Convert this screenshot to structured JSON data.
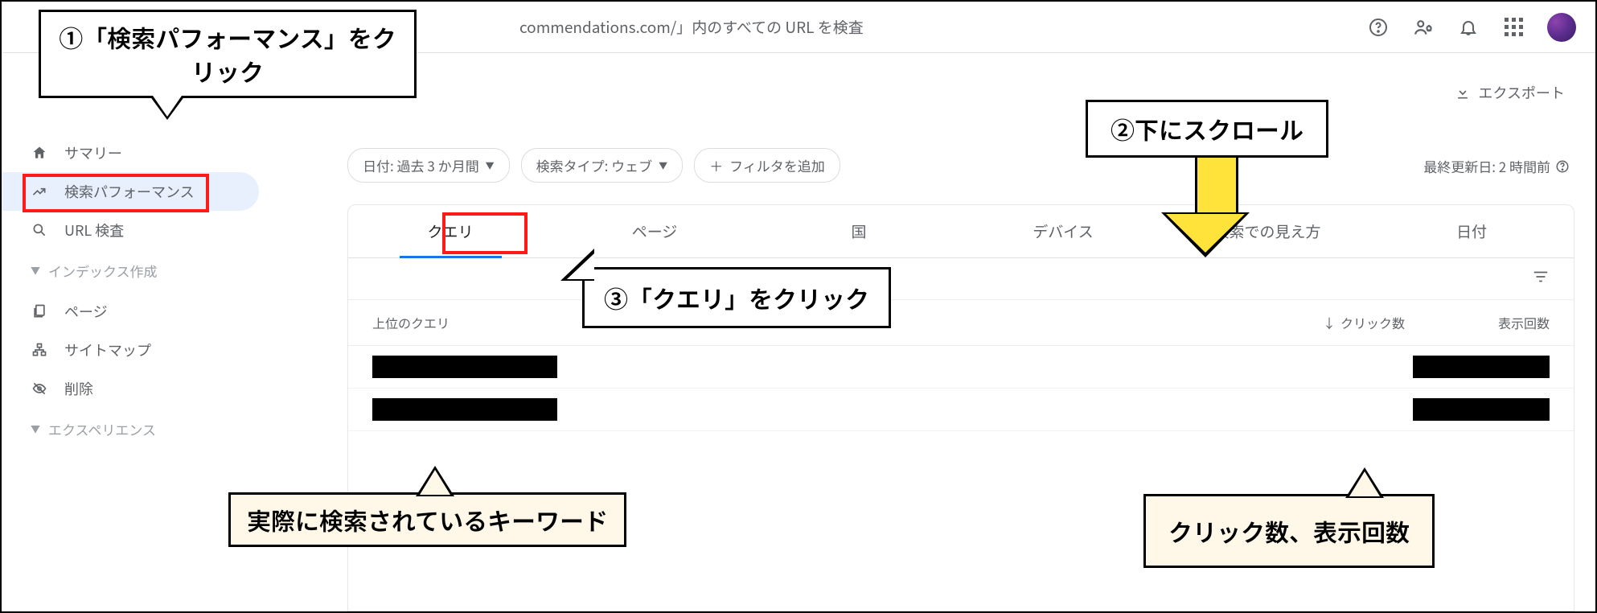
{
  "topbar": {
    "search_hint": "commendations.com/」内のすべての URL を検査"
  },
  "export_label": "エクスポート",
  "sidebar": {
    "summary": "サマリー",
    "performance": "検索パフォーマンス",
    "url_inspect": "URL 検査",
    "section_indexing": "インデックス作成",
    "pages": "ページ",
    "sitemap": "サイトマップ",
    "removals": "削除",
    "section_experience": "エクスペリエンス"
  },
  "chips": {
    "date": "日付: 過去 3 か月間",
    "type": "検索タイプ: ウェブ",
    "add_filter": "フィルタを追加"
  },
  "last_update": "最終更新日: 2 時間前",
  "tabs": {
    "query": "クエリ",
    "page": "ページ",
    "country": "国",
    "device": "デバイス",
    "appearance": "検索での見え方",
    "date": "日付"
  },
  "table": {
    "top_queries": "上位のクエリ",
    "clicks": "クリック数",
    "impressions": "表示回数"
  },
  "callouts": {
    "c1": "①「検索パフォーマンス」をクリック",
    "c2": "②下にスクロール",
    "c3": "③「クエリ」をクリック",
    "c4": "実際に検索されているキーワード",
    "c5": "クリック数、表示回数"
  }
}
